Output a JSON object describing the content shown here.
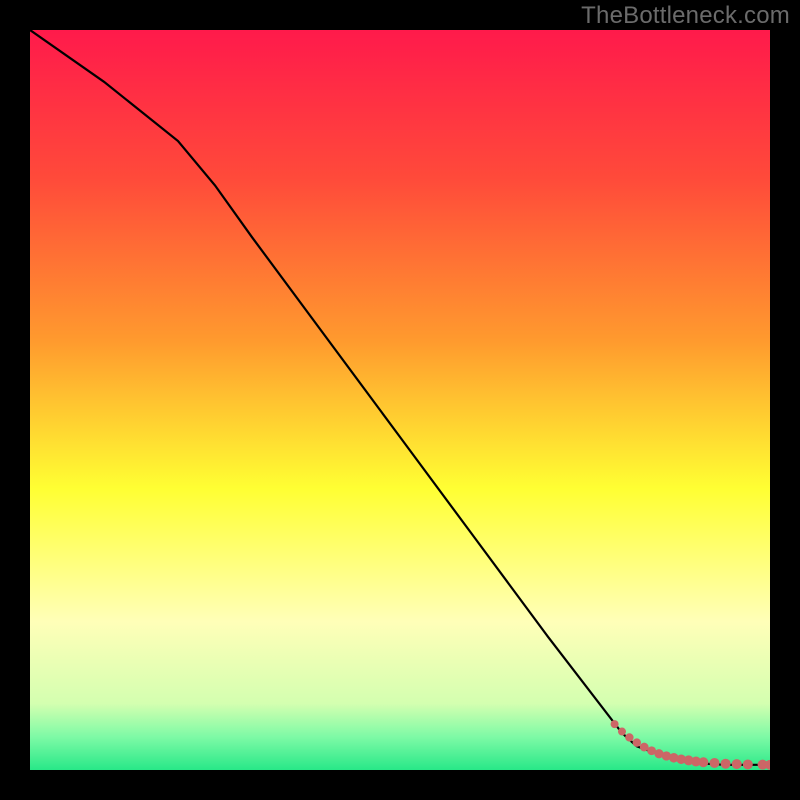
{
  "watermark": "TheBottleneck.com",
  "colors": {
    "red": "#ff1a4b",
    "orange": "#ff8a2a",
    "yellow": "#ffff33",
    "pale_yellow": "#ffffc0",
    "green": "#2ee88b",
    "line": "#000000",
    "dot": "#cc6666",
    "frame": "#000000"
  },
  "chart_data": {
    "type": "line",
    "title": "",
    "xlabel": "",
    "ylabel": "",
    "xlim": [
      0,
      100
    ],
    "ylim": [
      0,
      100
    ],
    "gradient_stops_vertical": [
      {
        "pos": 0.0,
        "color": "#ff1a4b"
      },
      {
        "pos": 0.2,
        "color": "#ff4a3a"
      },
      {
        "pos": 0.42,
        "color": "#ff9a2e"
      },
      {
        "pos": 0.62,
        "color": "#ffff33"
      },
      {
        "pos": 0.8,
        "color": "#ffffb8"
      },
      {
        "pos": 0.91,
        "color": "#d4ffb0"
      },
      {
        "pos": 0.955,
        "color": "#7efaa6"
      },
      {
        "pos": 1.0,
        "color": "#28e888"
      }
    ],
    "series": [
      {
        "name": "bottleneck-curve",
        "x": [
          0,
          10,
          20,
          25,
          30,
          40,
          50,
          60,
          70,
          80,
          82,
          85,
          88,
          90,
          92,
          94,
          96,
          98,
          100
        ],
        "y": [
          100,
          93,
          85,
          79,
          72,
          58.5,
          45,
          31.5,
          18,
          5,
          3.2,
          2.1,
          1.4,
          1.0,
          0.8,
          0.7,
          0.7,
          0.7,
          0.7
        ]
      }
    ],
    "scatter": {
      "name": "bottleneck-dots",
      "x": [
        79,
        80,
        81,
        82,
        83,
        84,
        85,
        86,
        87,
        88,
        89,
        90,
        91,
        92.5,
        94,
        95.5,
        97,
        99,
        100
      ],
      "y": [
        6.2,
        5.2,
        4.4,
        3.7,
        3.1,
        2.6,
        2.2,
        1.9,
        1.65,
        1.45,
        1.3,
        1.15,
        1.05,
        0.95,
        0.85,
        0.8,
        0.75,
        0.72,
        0.7
      ],
      "r": [
        4,
        4,
        4.2,
        4.2,
        4.4,
        4.4,
        4.6,
        4.6,
        4.8,
        4.8,
        5,
        5,
        5,
        5,
        5,
        5,
        5,
        5,
        5
      ]
    }
  }
}
